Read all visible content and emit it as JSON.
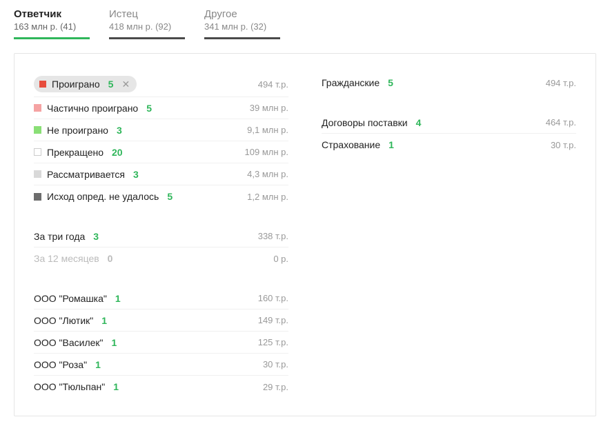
{
  "tabs": [
    {
      "label": "Ответчик",
      "sub": "163 млн р. (41)",
      "active": true
    },
    {
      "label": "Истец",
      "sub": "418 млн р. (92)",
      "active": false
    },
    {
      "label": "Другое",
      "sub": "341 млн р. (32)",
      "active": false
    }
  ],
  "outcomes": [
    {
      "swatch": "sw-red",
      "label": "Проиграно",
      "count": "5",
      "amount": "494 т.р.",
      "chip": true
    },
    {
      "swatch": "sw-pink",
      "label": "Частично проиграно",
      "count": "5",
      "amount": "39 млн р."
    },
    {
      "swatch": "sw-green",
      "label": "Не проиграно",
      "count": "3",
      "amount": "9,1 млн р."
    },
    {
      "swatch": "sw-white",
      "label": "Прекращено",
      "count": "20",
      "amount": "109 млн р."
    },
    {
      "swatch": "sw-lightgray",
      "label": "Рассматривается",
      "count": "3",
      "amount": "4,3 млн р."
    },
    {
      "swatch": "sw-darkgray",
      "label": "Исход опред. не удалось",
      "count": "5",
      "amount": "1,2 млн р."
    }
  ],
  "periods": [
    {
      "label": "За три года",
      "count": "3",
      "amount": "338 т.р."
    },
    {
      "label": "За 12 месяцев",
      "count": "0",
      "amount": "0 р.",
      "muted": true
    }
  ],
  "companies": [
    {
      "label": "ООО \"Ромашка\"",
      "count": "1",
      "amount": "160 т.р."
    },
    {
      "label": "ООО \"Лютик\"",
      "count": "1",
      "amount": "149 т.р."
    },
    {
      "label": "ООО \"Василек\"",
      "count": "1",
      "amount": "125 т.р."
    },
    {
      "label": "ООО \"Роза\"",
      "count": "1",
      "amount": "30 т.р."
    },
    {
      "label": "ООО \"Тюльпан\"",
      "count": "1",
      "amount": "29 т.р."
    }
  ],
  "categories_top": [
    {
      "label": "Гражданские",
      "count": "5",
      "amount": "494 т.р."
    }
  ],
  "categories_bottom": [
    {
      "label": "Договоры поставки",
      "count": "4",
      "amount": "464 т.р."
    },
    {
      "label": "Страхование",
      "count": "1",
      "amount": "30 т.р."
    }
  ]
}
